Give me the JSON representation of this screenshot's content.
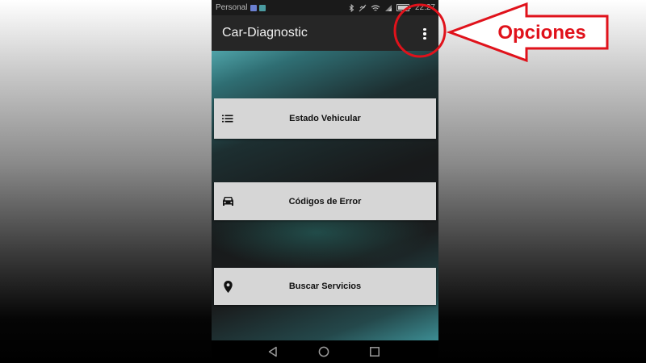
{
  "status_bar": {
    "carrier": "Personal",
    "time": "22:27",
    "icons": [
      "notification-icon-blue",
      "notification-icon-teal",
      "bluetooth-icon",
      "no-sound-icon",
      "wifi-icon",
      "signal-icon",
      "battery-icon"
    ]
  },
  "app_bar": {
    "title": "Car-Diagnostic",
    "overflow_icon": "more-vert-icon"
  },
  "menu": {
    "items": [
      {
        "label": "Estado Vehicular",
        "icon": "list-icon"
      },
      {
        "label": "Códigos de Error",
        "icon": "car-icon"
      },
      {
        "label": "Buscar Servicios",
        "icon": "location-pin-icon"
      }
    ]
  },
  "nav_bar": {
    "icons": [
      "back-icon",
      "home-icon",
      "recents-icon"
    ]
  },
  "annotation": {
    "label": "Opciones",
    "color": "#e0121b"
  }
}
